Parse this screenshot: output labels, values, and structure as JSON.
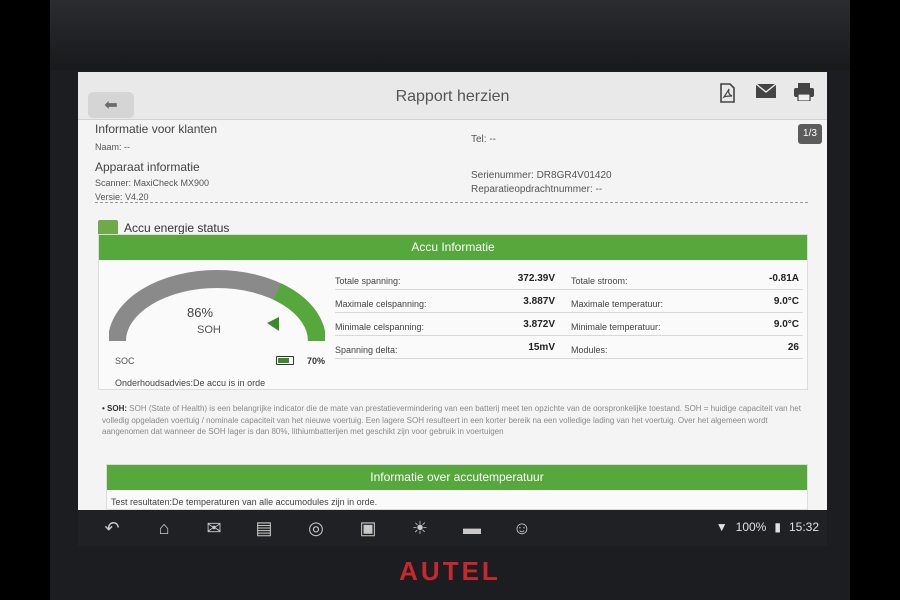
{
  "titlebar": {
    "title": "Rapport herzien",
    "icons": [
      "back-arrow-icon",
      "pdf-icon",
      "mail-icon",
      "print-icon"
    ]
  },
  "page_indicator": "1/3",
  "customer": {
    "heading": "Informatie voor klanten",
    "name_label": "Naam: --",
    "tel_label": "Tel: --"
  },
  "device": {
    "heading": "Apparaat informatie",
    "scanner": "Scanner: MaxiCheck MX900",
    "version": "Versie: V4.20",
    "serial": "Serienummer: DR8GR4V01420",
    "repair_no": "Reparatieopdrachtnummer: --"
  },
  "accu_status": {
    "title": "Accu energie status",
    "panel_title": "Accu Informatie",
    "soh_value": "86%",
    "soh_label": "SOH",
    "soh_fraction": 0.86,
    "soc_label": "SOC",
    "soc_value": "70%",
    "advice": "Onderhoudsadvies:De accu is in orde",
    "rows": [
      {
        "label1": "Totale spanning:",
        "value1": "372.39V",
        "label2": "Totale stroom:",
        "value2": "-0.81A"
      },
      {
        "label1": "Maximale celspanning:",
        "value1": "3.887V",
        "label2": "Maximale temperatuur:",
        "value2": "9.0°C"
      },
      {
        "label1": "Minimale celspanning:",
        "value1": "3.872V",
        "label2": "Minimale temperatuur:",
        "value2": "9.0°C"
      },
      {
        "label1": "Spanning delta:",
        "value1": "15mV",
        "label2": "Modules:",
        "value2": "26"
      }
    ]
  },
  "soh_note": {
    "prefix": "• SOH:",
    "text": " SOH (State of Health) is een belangrijke indicator die de mate van prestatievermindering van een batterij meet ten opzichte van de oorspronkelijke toestand. SOH = huidige capaciteit van het volledig opgeladen voertuig / nominale capaciteit van het nieuwe voertuig. Een lagere SOH resulteert in een korter bereik na een volledige lading van het voertuig. Over het algemeen wordt aangenomen dat wanneer de SOH lager is dan 80%, lithiumbatterijen met geschikt zijn voor gebruik in voertuigen"
  },
  "temperature": {
    "panel_title": "Informatie over accutemperatuur",
    "result": "Test resultaten:De temperaturen van alle accumodules zijn in orde."
  },
  "navbar": {
    "icons": [
      "back-icon",
      "home-icon",
      "inbox-icon",
      "recent-apps-icon",
      "chrome-icon",
      "camera-icon",
      "brightness-icon",
      "vehicle-icon",
      "user-icon"
    ],
    "battery": "100%",
    "time": "15:32"
  },
  "brand": "AUTEL",
  "colors": {
    "accent_green": "#56a83c",
    "brand_red": "#c8282d",
    "gauge_gray": "#8a8a8a"
  }
}
